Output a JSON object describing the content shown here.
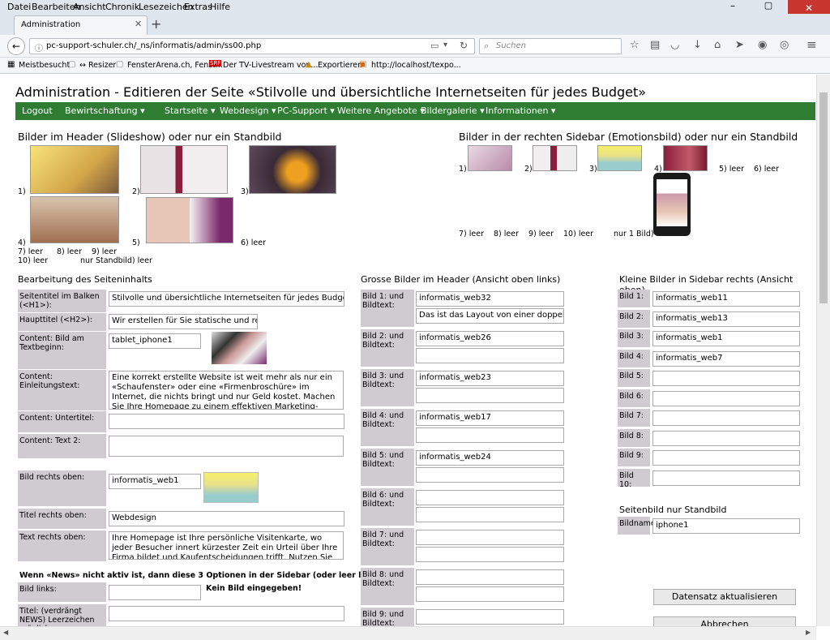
{
  "menubar": [
    "Datei",
    "Bearbeiten",
    "Ansicht",
    "Chronik",
    "Lesezeichen",
    "Extras",
    "Hilfe"
  ],
  "tab": {
    "title": "Administration"
  },
  "url": "pc-support-schuler.ch/_ns/informatis/admin/ss00.php",
  "search_placeholder": "Suchen",
  "bookmarks": [
    "Meistbesucht",
    "↔ Resizer",
    "FensterArena.ch, Fenst...",
    "Der TV-Livestream von...",
    "Exportieren",
    "http://localhost/texpo..."
  ],
  "page": {
    "title": "Administration - Editieren der Seite «Stilvolle und übersichtliche Internetseiten für jedes Budget»",
    "nav": [
      "Logout",
      "Bewirtschaftung ▾",
      "Startseite ▾",
      "Webdesign ▾",
      "PC-Support ▾",
      "Weitere Angebote ▾",
      "Bildergalerie ▾",
      "Informationen ▾"
    ],
    "header_section": "Bilder im Header (Slideshow) oder nur ein Standbild",
    "header_labels": [
      "1)",
      "2)",
      "3)",
      "4)",
      "5)",
      "6) leer",
      "7) leer",
      "8) leer",
      "9) leer",
      "10) leer",
      "nur Standbild) leer"
    ],
    "sidebar_section": "Bilder in der rechten Sidebar (Emotionsbild) oder nur ein Standbild",
    "sidebar_labels": [
      "1)",
      "2)",
      "3)",
      "4)",
      "5) leer",
      "6) leer",
      "7) leer",
      "8) leer",
      "9) leer",
      "10) leer",
      "nur 1 Bild)"
    ],
    "content_section": "Bearbeitung des Seiteninhalts",
    "fields": {
      "seitentitel_label": "Seitentitel im Balken (<H1>):",
      "seitentitel": "Stilvolle und übersichtliche Internetseiten für jedes Budget",
      "haupttitel_label": "Haupttitel (<H2>):",
      "haupttitel": "Wir erstellen für Sie statische und resp",
      "bild_label": "Content: Bild am Textbeginn:",
      "bild": "tablet_iphone1",
      "einleitung_label": "Content: Einleitungstext:",
      "einleitung": "Eine korrekt erstellte Website ist weit mehr als nur ein «Schaufenster» oder eine «Firmenbroschüre» im Internet, die nichts bringt und nur Geld kostet. Machen Sie Ihre Homepage zu einem effektiven Marketing-Instrument, das",
      "untertitel_label": "Content: Untertitel:",
      "text2_label": "Content: Text 2:",
      "bild_rechts_label": "Bild rechts oben:",
      "bild_rechts": "informatis_web1",
      "titel_rechts_label": "Titel rechts oben:",
      "titel_rechts": "Webdesign",
      "text_rechts_label": "Text rechts oben:",
      "text_rechts": "Ihre Homepage ist Ihre persönliche Visitenkarte, wo jeder Besucher innert kürzester Zeit ein Urteil über Ihre Firma bildet und Kaufentscheidungen trifft. Nutzen Sie diese",
      "news_note": "Wenn «News» nicht aktiv ist, dann diese 3 Optionen in der Sidebar (oder leer lassen)",
      "bild_links_label": "Bild links:",
      "kein_bild": "Kein Bild eingegeben!",
      "titel_news_label": "Titel: (verdrängt NEWS) Leerzeichen möglich"
    },
    "grosse_section": "Grosse Bilder im Header (Ansicht oben links)",
    "grosse": [
      {
        "label": "Bild 1: und Bildtext:",
        "bild": "informatis_web32",
        "text": "Das ist das Layout von einer doppelten '"
      },
      {
        "label": "Bild 2: und Bildtext:",
        "bild": "informatis_web26",
        "text": ""
      },
      {
        "label": "Bild 3: und Bildtext:",
        "bild": "informatis_web23",
        "text": ""
      },
      {
        "label": "Bild 4: und Bildtext:",
        "bild": "informatis_web17",
        "text": ""
      },
      {
        "label": "Bild 5: und Bildtext:",
        "bild": "informatis_web24",
        "text": ""
      },
      {
        "label": "Bild 6: und Bildtext:",
        "bild": "",
        "text": ""
      },
      {
        "label": "Bild 7: und Bildtext:",
        "bild": "",
        "text": ""
      },
      {
        "label": "Bild 8: und Bildtext:",
        "bild": "",
        "text": ""
      },
      {
        "label": "Bild 9: und Bildtext:",
        "bild": "",
        "text": ""
      }
    ],
    "kleine_section": "Kleine Bilder in Sidebar rechts (Ansicht oben)",
    "kleine": [
      {
        "label": "Bild 1:",
        "value": "informatis_web11"
      },
      {
        "label": "Bild 2:",
        "value": "informatis_web13"
      },
      {
        "label": "Bild 3:",
        "value": "informatis_web1"
      },
      {
        "label": "Bild 4:",
        "value": "informatis_web7"
      },
      {
        "label": "Bild 5:",
        "value": ""
      },
      {
        "label": "Bild 6:",
        "value": ""
      },
      {
        "label": "Bild 7:",
        "value": ""
      },
      {
        "label": "Bild 8:",
        "value": ""
      },
      {
        "label": "Bild 9:",
        "value": ""
      },
      {
        "label": "Bild 10:",
        "value": ""
      }
    ],
    "standbild_section": "Seitenbild nur Standbild",
    "bildname_label": "Bildname",
    "bildname": "iphone1",
    "btn_update": "Datensatz aktualisieren",
    "btn_cancel": "Abbrechen"
  },
  "colors": {
    "nav": "#2e7d32",
    "label_bg": "#cfcbd0"
  }
}
